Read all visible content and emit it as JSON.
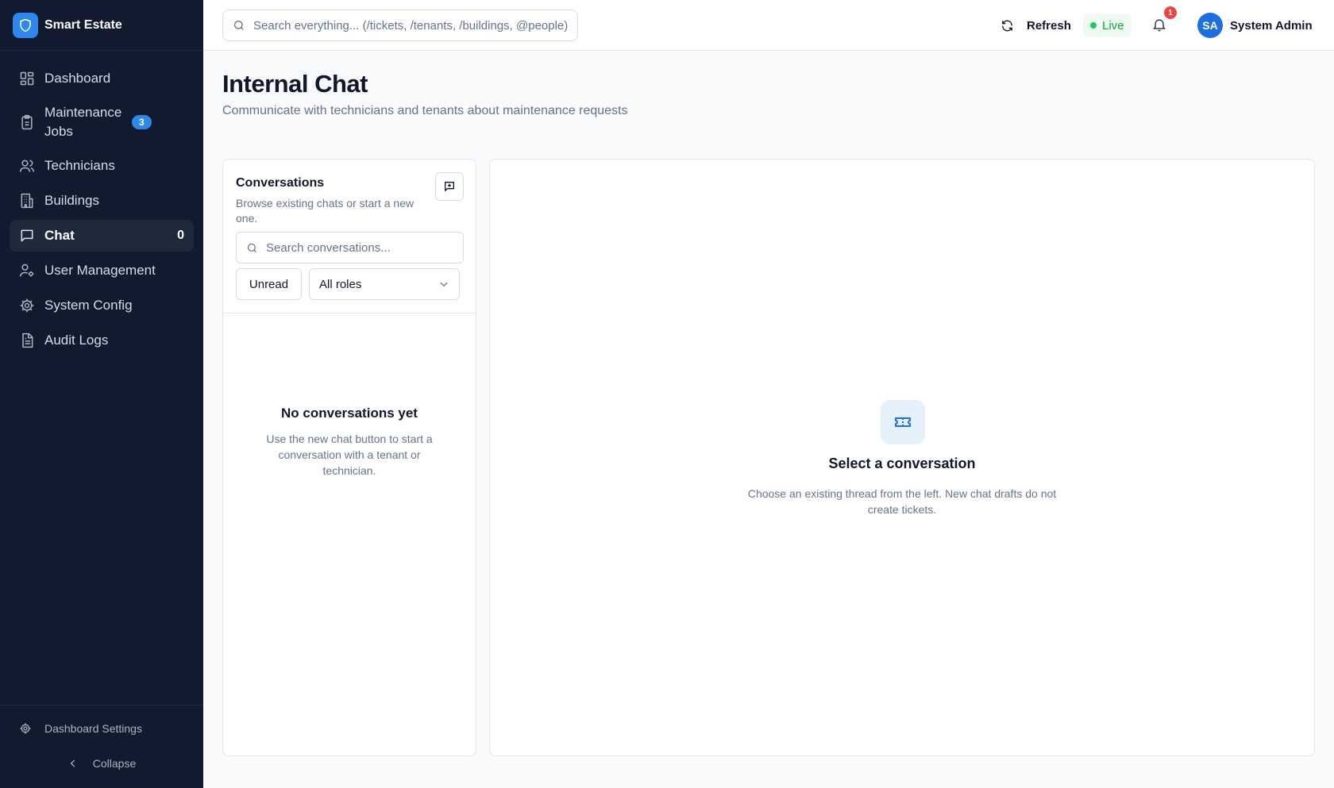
{
  "brand": {
    "name": "Smart Estate",
    "logo_icon": "shield-icon",
    "accent": "#2f86eb"
  },
  "sidebar": {
    "items": [
      {
        "label": "Dashboard",
        "icon": "dashboard-grid-icon"
      },
      {
        "label": "Maintenance Jobs",
        "icon": "clipboard-icon",
        "badge": "3"
      },
      {
        "label": "Technicians",
        "icon": "users-icon"
      },
      {
        "label": "Buildings",
        "icon": "building-icon"
      },
      {
        "label": "Chat",
        "icon": "message-square-icon",
        "count": "0",
        "active": true
      },
      {
        "label": "User Management",
        "icon": "user-cog-icon"
      },
      {
        "label": "System Config",
        "icon": "gear-icon"
      },
      {
        "label": "Audit Logs",
        "icon": "file-text-icon"
      }
    ],
    "settings_label": "Dashboard Settings",
    "collapse_label": "Collapse"
  },
  "header": {
    "search_placeholder": "Search everything... (/tickets, /tenants, /buildings, @people)",
    "refresh_label": "Refresh",
    "live_label": "Live",
    "notification_count": "1",
    "user": {
      "initials": "SA",
      "name": "System Admin"
    }
  },
  "page": {
    "title": "Internal Chat",
    "subtitle": "Communicate with technicians and tenants about maintenance requests"
  },
  "conversations": {
    "title": "Conversations",
    "description": "Browse existing chats or start a new one.",
    "search_placeholder": "Search conversations...",
    "unread_label": "Unread",
    "role_filter": "All roles",
    "empty_title": "No conversations yet",
    "empty_desc": "Use the new chat button to start a conversation with a tenant or technician."
  },
  "thread": {
    "title": "Select a conversation",
    "description": "Choose an existing thread from the left. New chat drafts do not create tickets.",
    "icon": "ticket-icon"
  },
  "colors": {
    "sidebar_bg": "#111a2e",
    "live_green": "#16a34a",
    "badge_red": "#ef4444"
  }
}
